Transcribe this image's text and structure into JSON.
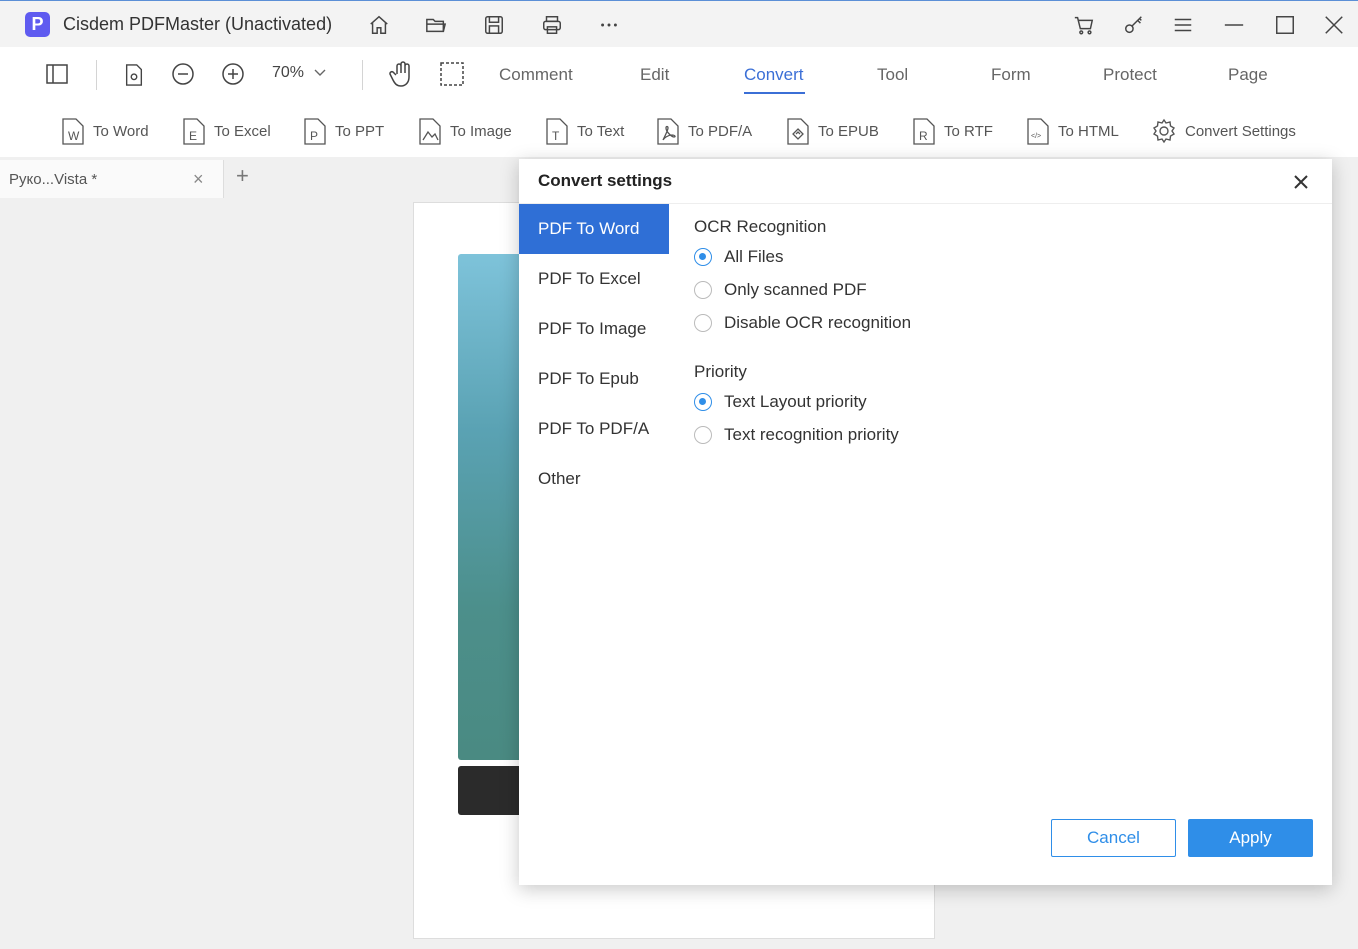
{
  "window": {
    "app_logo_letter": "P",
    "title": "Cisdem PDFMaster (Unactivated)"
  },
  "toolbar": {
    "zoom": "70%",
    "menu_tabs": [
      "Comment",
      "Edit",
      "Convert",
      "Tool",
      "Form",
      "Protect",
      "Page"
    ],
    "active_tab": "Convert"
  },
  "convert_tools": [
    "To Word",
    "To Excel",
    "To PPT",
    "To Image",
    "To Text",
    "To PDF/A",
    "To EPUB",
    "To RTF",
    "To HTML",
    "Convert Settings"
  ],
  "doc_tab": {
    "label": "Руко...Vista *",
    "close": "×",
    "add": "+"
  },
  "dialog": {
    "title": "Convert settings",
    "sidebar": [
      "PDF To Word",
      "PDF To Excel",
      "PDF To Image",
      "PDF To Epub",
      "PDF To PDF/A",
      "Other"
    ],
    "active_sidebar": "PDF To Word",
    "ocr": {
      "label": "OCR Recognition",
      "options": [
        "All Files",
        "Only scanned PDF",
        "Disable OCR recognition"
      ],
      "selected": "All Files"
    },
    "priority": {
      "label": "Priority",
      "options": [
        "Text Layout priority",
        "Text recognition priority"
      ],
      "selected": "Text Layout priority"
    },
    "cancel_label": "Cancel",
    "apply_label": "Apply"
  },
  "colors": {
    "accent": "#2f6fd6",
    "button_blue": "#2f8ee8",
    "logo": "#5f5bf0"
  }
}
